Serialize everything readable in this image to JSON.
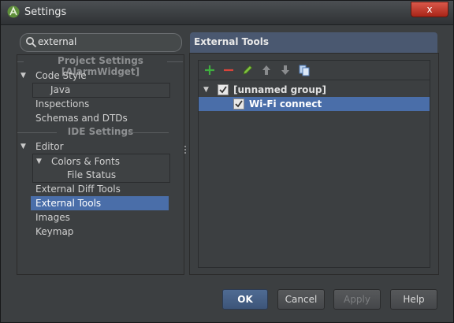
{
  "window": {
    "title": "Settings",
    "close_label": "x"
  },
  "search": {
    "value": "external"
  },
  "left_tree": {
    "project_header": "Project Settings [AlarmWidget]",
    "ide_header": "IDE Settings",
    "items": {
      "code_style": "Code Style",
      "java": "Java",
      "inspections": "Inspections",
      "schemas": "Schemas and DTDs",
      "editor": "Editor",
      "colors_fonts": "Colors & Fonts",
      "file_status": "File Status",
      "external_diff": "External Diff Tools",
      "external_tools": "External Tools",
      "images": "Images",
      "keymap": "Keymap"
    }
  },
  "panel": {
    "title": "External Tools",
    "tree": {
      "group": "[unnamed group]",
      "tool": "Wi-Fi connect"
    }
  },
  "buttons": {
    "ok": "OK",
    "cancel": "Cancel",
    "apply": "Apply",
    "help": "Help"
  },
  "colors": {
    "selection": "#4a6ea9",
    "header": "#4a5870",
    "add": "#3fae3f",
    "remove": "#d9443a"
  }
}
